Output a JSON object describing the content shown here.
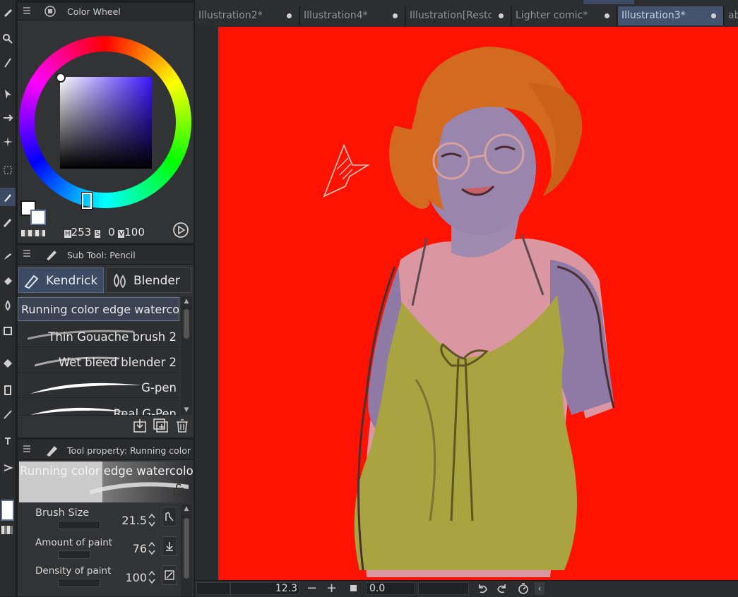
{
  "tabs": [
    {
      "label": "Illustration2*"
    },
    {
      "label": "Illustration4*"
    },
    {
      "label": "Illustration[Restored]"
    },
    {
      "label": "Lighter comic*"
    },
    {
      "label": "Illustration3*"
    },
    {
      "label": "ab"
    }
  ],
  "color_wheel": {
    "title": "Color Wheel",
    "h_label": "H",
    "h_value": "253",
    "s_label": "S",
    "s_value": "0",
    "v_label": "V",
    "v_value": "100",
    "square_color": "#3b16ff",
    "main_color": "#ffffff",
    "sub_color": "#ffffff"
  },
  "sub_tool": {
    "title": "Sub Tool: Pencil",
    "groups": [
      {
        "label": "Kendrick"
      },
      {
        "label": "Blender"
      }
    ],
    "brushes": [
      {
        "label": "Running color edge watercolor"
      },
      {
        "label": "Thin Gouache brush 2"
      },
      {
        "label": "Wet bleed blender 2"
      },
      {
        "label": "G-pen"
      },
      {
        "label": "Real G-Pen"
      }
    ]
  },
  "tool_property": {
    "title": "Tool property: Running color edge watercolor",
    "brush_name": "Running color edge watercolor",
    "properties": [
      {
        "label": "Brush Size",
        "value": "21.5"
      },
      {
        "label": "Amount of paint",
        "value": "76"
      },
      {
        "label": "Density of paint",
        "value": "100"
      }
    ]
  },
  "status": {
    "zoom": "12.3",
    "rotation": "0.0"
  },
  "colors": {
    "canvas_background": "#ff1200",
    "accent": "#44546e"
  },
  "icons": [
    "pen-icon",
    "search-icon",
    "pencil-icon",
    "arrow-icon",
    "move-icon",
    "sparkle-icon",
    "marquee-icon",
    "eyedropper-icon",
    "brush-icon",
    "fill-icon",
    "eraser-icon",
    "decoration-icon",
    "gradient-icon",
    "figure-icon",
    "text-icon",
    "ruler-icon",
    "import-icon",
    "duplicate-icon",
    "trash-icon",
    "lock-icon",
    "undo-icon",
    "redo-icon"
  ]
}
